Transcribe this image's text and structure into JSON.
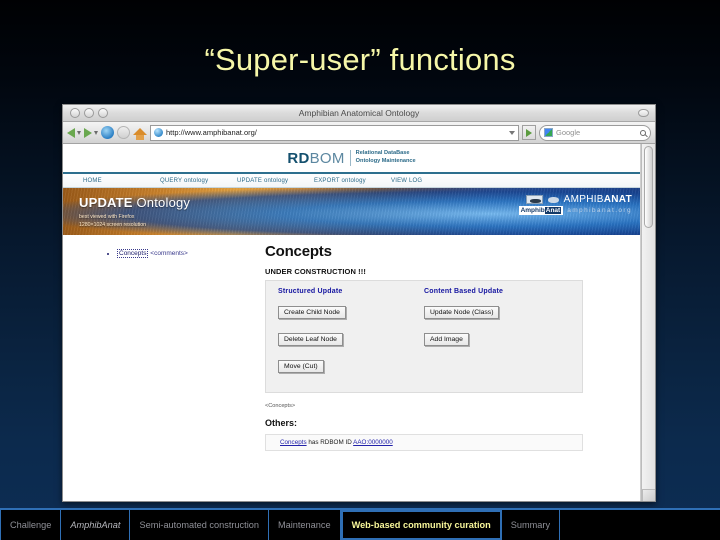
{
  "slide": {
    "title": "“Super-user” functions",
    "title_color": "#f6f7a8",
    "background_color": "#0a2340"
  },
  "browser": {
    "window_title": "Amphibian Anatomical Ontology",
    "toolbar": {
      "back_icon": "back-arrow-icon",
      "forward_icon": "forward-arrow-icon",
      "reload_icon": "reload-icon",
      "stop_icon": "stop-icon",
      "home_icon": "home-icon",
      "url": "http://www.amphibanat.org/",
      "go_label": "Go",
      "search_placeholder": "Google"
    }
  },
  "site": {
    "logo_bold": "RD",
    "logo_light": "BOM",
    "logo_subtitle_line1": "Relational DataBase",
    "logo_subtitle_line2": "Ontology Maintenance",
    "nav": [
      {
        "label": "HOME"
      },
      {
        "label": "QUERY ontology"
      },
      {
        "label": "UPDATE ontology"
      },
      {
        "label": "EXPORT ontology"
      },
      {
        "label": "VIEW LOG"
      }
    ],
    "banner": {
      "title_bold": "UPDATE",
      "title_light": " Ontology",
      "subtitle_line1": "best viewed with Firefox",
      "subtitle_line2": "1280×1024 screen resolution",
      "brand_light": "AMPHIB",
      "brand_bold": "ANAT",
      "badge_left": "Amphib",
      "badge_right": "Anat",
      "domain": "amphibanat.org"
    }
  },
  "tree": {
    "node_label": "Concepts",
    "node_comment": "<comments>"
  },
  "panel": {
    "heading": "Concepts",
    "under_construction": "UNDER CONSTRUCTION !!!",
    "columns": [
      {
        "heading": "Structured Update",
        "buttons": [
          {
            "label": "Create Child Node"
          },
          {
            "label": "Delete Leaf Node"
          },
          {
            "label": "Move (Cut)"
          }
        ]
      },
      {
        "heading": "Content Based Update",
        "buttons": [
          {
            "label": "Update Node (Class)"
          },
          {
            "label": "Add Image"
          }
        ]
      }
    ],
    "after_box_text": "<Concepts>",
    "others_heading": "Others:",
    "id_line": {
      "link_text": "Concepts",
      "middle_text": " has RDBOM ID ",
      "id_text": "AAO:0000000"
    }
  },
  "bottom_nav": {
    "active_color": "#f7f69a",
    "border_color": "#2f6fb5",
    "items": [
      {
        "label": "Challenge",
        "style": "normal",
        "active": false
      },
      {
        "label": "AmphibAnat",
        "style": "italic",
        "active": false
      },
      {
        "label": "Semi-automated construction",
        "style": "normal",
        "active": false
      },
      {
        "label": "Maintenance",
        "style": "normal",
        "active": false
      },
      {
        "label": "Web-based community curation",
        "style": "normal",
        "active": true
      },
      {
        "label": "Summary",
        "style": "normal",
        "active": false
      }
    ]
  }
}
